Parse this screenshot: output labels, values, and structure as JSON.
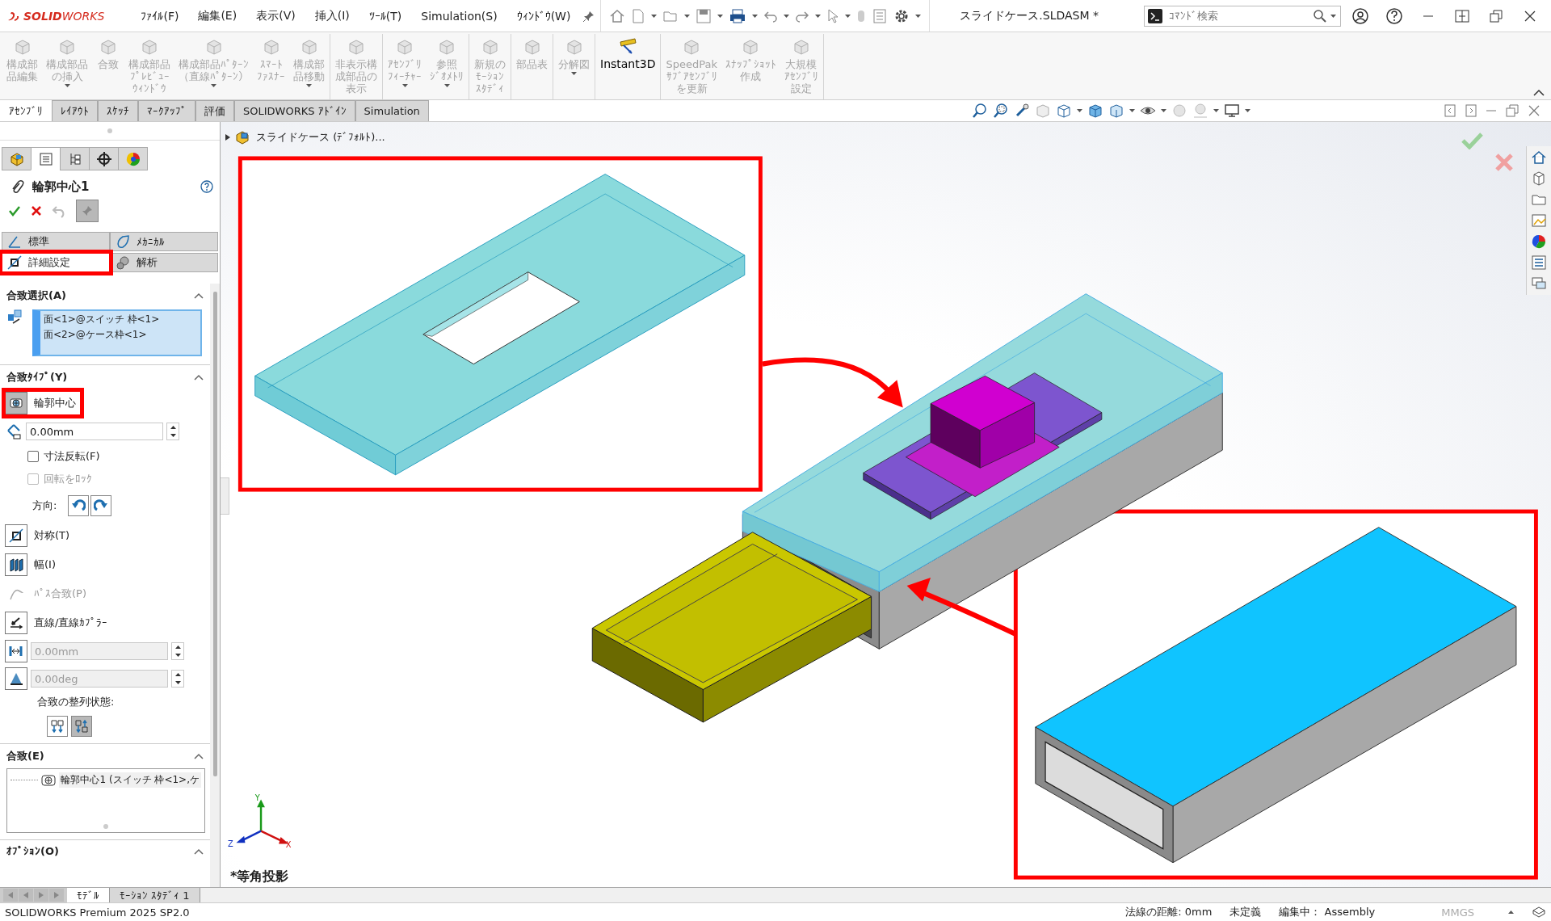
{
  "app": {
    "logo": "**SOLID**WORKS",
    "menu": [
      "ﾌｧｲﾙ(F)",
      "編集(E)",
      "表示(V)",
      "挿入(I)",
      "ﾂｰﾙ(T)",
      "Simulation(S)",
      "ｳｨﾝﾄﾞｳ(W)"
    ],
    "document_title": "スライドケース.SLDASM *",
    "command_search": {
      "placeholder": "ｺﾏﾝﾄﾞ検索"
    }
  },
  "ribbon": [
    [
      {
        "lines": [
          "構成部",
          "品編集"
        ],
        "disabled": true,
        "dropdown": false
      },
      {
        "lines": [
          "構成部品",
          "の挿入"
        ],
        "disabled": true,
        "dropdown": true
      },
      {
        "lines": [
          "合致"
        ],
        "disabled": true,
        "dropdown": false
      },
      {
        "lines": [
          "構成部品",
          "ﾌﾟﾚﾋﾞｭｰ",
          "ｳｨﾝﾄﾞｳ"
        ],
        "disabled": true,
        "dropdown": false
      },
      {
        "lines": [
          "構成部品ﾊﾟﾀｰﾝ",
          "（直線ﾊﾟﾀｰﾝ）"
        ],
        "disabled": true,
        "dropdown": true
      },
      {
        "lines": [
          "ｽﾏｰﾄ",
          "ﾌｧｽﾅｰ"
        ],
        "disabled": true,
        "dropdown": false
      },
      {
        "lines": [
          "構成部",
          "品移動"
        ],
        "disabled": true,
        "dropdown": true
      }
    ],
    [
      {
        "lines": [
          "非表示構",
          "成部品の",
          "表示"
        ],
        "disabled": true,
        "dropdown": false
      }
    ],
    [
      {
        "lines": [
          "ｱｾﾝﾌﾞﾘ",
          "ﾌｨｰﾁｬｰ"
        ],
        "disabled": true,
        "dropdown": true
      },
      {
        "lines": [
          "参照",
          "ｼﾞｵﾒﾄﾘ"
        ],
        "disabled": true,
        "dropdown": true
      }
    ],
    [
      {
        "lines": [
          "新規の",
          "ﾓｰｼｮﾝ",
          "ｽﾀﾃﾞｨ"
        ],
        "disabled": true,
        "dropdown": false
      }
    ],
    [
      {
        "lines": [
          "部品表"
        ],
        "disabled": true,
        "dropdown": false
      }
    ],
    [
      {
        "lines": [
          "分解図"
        ],
        "disabled": true,
        "dropdown": true
      }
    ],
    [
      {
        "lines": [
          "Instant3D"
        ],
        "disabled": false,
        "dropdown": false
      }
    ],
    [
      {
        "lines": [
          "SpeedPak",
          "ｻﾌﾞｱｾﾝﾌﾞﾘ",
          "を更新"
        ],
        "disabled": true,
        "dropdown": false
      },
      {
        "lines": [
          "ｽﾅｯﾌﾟｼｮｯﾄ",
          "作成"
        ],
        "disabled": true,
        "dropdown": false
      },
      {
        "lines": [
          "大規模",
          "ｱｾﾝﾌﾞﾘ",
          "設定"
        ],
        "disabled": true,
        "dropdown": false
      }
    ]
  ],
  "document_tabs": [
    {
      "label": "ｱｾﾝﾌﾞﾘ",
      "selected": true
    },
    {
      "label": "ﾚｲｱｳﾄ",
      "selected": false
    },
    {
      "label": "ｽｹｯﾁ",
      "selected": false
    },
    {
      "label": "ﾏｰｸｱｯﾌﾟ",
      "selected": false
    },
    {
      "label": "評価",
      "selected": false
    },
    {
      "label": "SOLIDWORKS ｱﾄﾞｲﾝ",
      "selected": false
    },
    {
      "label": "Simulation",
      "selected": false
    }
  ],
  "property_manager": {
    "tabs": [
      {
        "selected": false
      },
      {
        "selected": true
      },
      {
        "selected": false
      },
      {
        "selected": false
      },
      {
        "selected": false
      }
    ],
    "title": "輪郭中心1",
    "mate_tabs": [
      {
        "label": "標準",
        "selected": false,
        "highlighted": false
      },
      {
        "label": "ﾒｶﾆｶﾙ",
        "selected": false,
        "highlighted": false
      },
      {
        "label": "詳細設定",
        "selected": true,
        "highlighted": true
      },
      {
        "label": "解析",
        "selected": false,
        "highlighted": false
      }
    ],
    "selection_section": {
      "title": "合致選択(A)",
      "entities": [
        "面<1>@スイッチ 枠<1>",
        "面<2>@ケース枠<1>"
      ]
    },
    "type_section": {
      "title": "合致ﾀｲﾌﾟ(Y)",
      "items": [
        {
          "kind": "type",
          "label": "輪郭中心",
          "selected": true,
          "highlighted": true,
          "disabled": false
        },
        {
          "kind": "field",
          "value": "0.00mm",
          "disabled": false
        },
        {
          "kind": "checkbox",
          "label": "寸法反転(F)",
          "checked": false,
          "disabled": false
        },
        {
          "kind": "checkbox",
          "label": "回転をﾛｯｸ",
          "checked": false,
          "disabled": true
        },
        {
          "kind": "direction",
          "label": "方向:"
        },
        {
          "kind": "type",
          "label": "対称(T)",
          "selected": false,
          "highlighted": false,
          "disabled": false
        },
        {
          "kind": "type",
          "label": "幅(I)",
          "selected": false,
          "highlighted": false,
          "disabled": false
        },
        {
          "kind": "type",
          "label": "ﾊﾟｽ合致(P)",
          "selected": false,
          "highlighted": false,
          "disabled": true
        },
        {
          "kind": "type",
          "label": "直線/直線ｶﾌﾟﾗｰ",
          "selected": false,
          "highlighted": false,
          "disabled": false
        },
        {
          "kind": "field",
          "value": "0.00mm",
          "disabled": true
        },
        {
          "kind": "field",
          "value": "0.00deg",
          "disabled": true
        },
        {
          "kind": "alignment",
          "label": "合致の整列状態:",
          "options": [
            {
              "selected": false
            },
            {
              "selected": true
            }
          ]
        }
      ]
    },
    "mates_section": {
      "title": "合致(E)",
      "items": [
        "輪郭中心1 (スイッチ 枠<1>,ケ"
      ]
    },
    "options_section": {
      "title": "ｵﾌﾟｼｮﾝ(O)"
    }
  },
  "viewport": {
    "breadcrumb": "スライドケース (ﾃﾞﾌｫﾙﾄ)...",
    "view_name": "*等角投影",
    "axes": {
      "x": "X",
      "y": "Y",
      "z": "Z"
    }
  },
  "bottom_tabs": [
    {
      "label": "ﾓﾃﾞﾙ",
      "selected": true
    },
    {
      "label": "ﾓｰｼｮﾝ ｽﾀﾃﾞｨ 1",
      "selected": false
    }
  ],
  "status_bar": {
    "product": "SOLIDWORKS Premium 2025 SP2.0",
    "fields": [
      "法線の距離: 0mm",
      "未定義",
      "編集中： Assembly"
    ],
    "units": "MMGS"
  }
}
